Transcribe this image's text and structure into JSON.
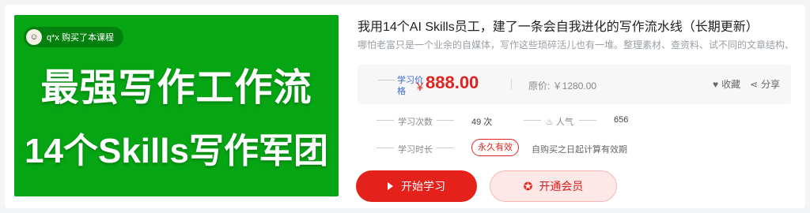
{
  "cover": {
    "buyer_text": "q*x 购买了本课程",
    "headline": "最强写作工作流",
    "subline": "14个Skills写作军团",
    "bg_color": "#06a514"
  },
  "course": {
    "title": "我用14个AI Skills员工，建了一条会自我进化的写作流水线（长期更新）",
    "description": "哪怕老富只是一个业余的自媒体，写作这些琐碎活儿也有一堆。整理素材、查资料、试不同的文章结构、"
  },
  "pricing": {
    "label": "学习价格",
    "currency": "￥",
    "price": "888.00",
    "original": "原价: ￥1280.00",
    "favorite_label": "收藏",
    "share_label": "分享",
    "accent_color": "#e0231f"
  },
  "stats": {
    "study_count_label": "学习次数",
    "study_count_value": "49 次",
    "popularity_label": "人气",
    "popularity_value": "656",
    "duration_label": "学习时长",
    "duration_badge": "永久有效",
    "duration_note": "自购买之日起计算有效期"
  },
  "actions": {
    "start_label": "开始学习",
    "member_label": "开通会员"
  },
  "icons": {
    "favorite": "heart-icon",
    "share": "share-icon",
    "popularity": "flame-icon",
    "play": "play-icon",
    "vip": "vip-badge-icon"
  }
}
